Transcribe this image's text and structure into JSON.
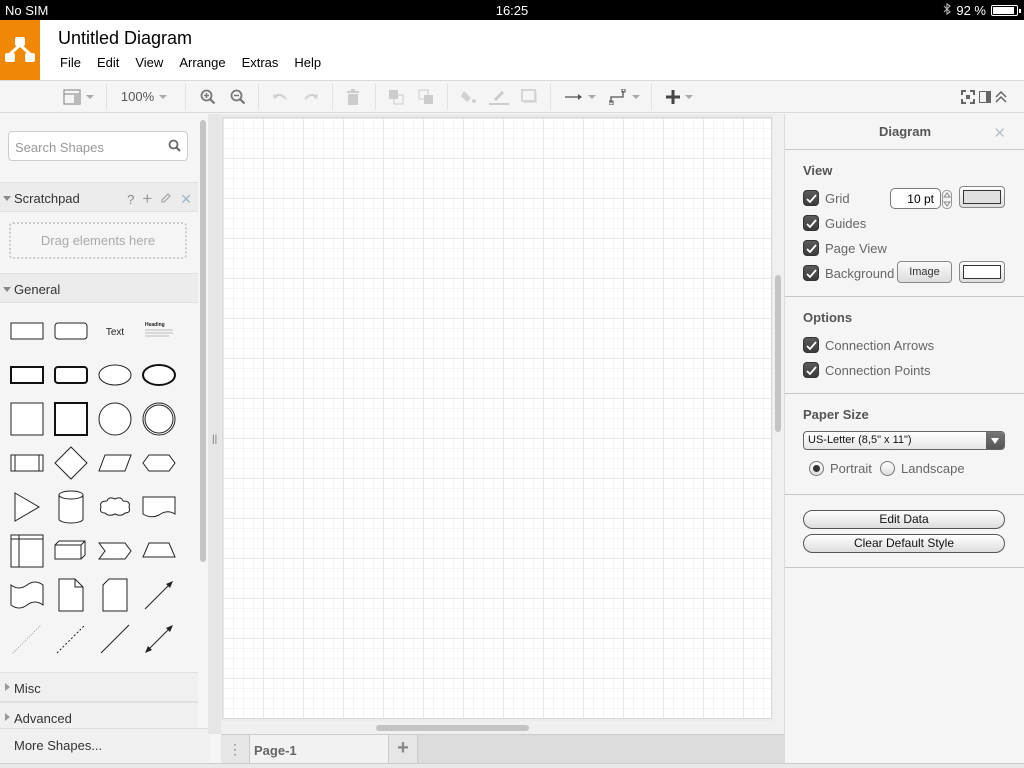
{
  "status_bar": {
    "carrier": "No SIM",
    "time": "16:25",
    "battery_percent_label": "92 %",
    "battery_level": 0.92,
    "bluetooth_icon": "bluetooth-icon"
  },
  "app": {
    "title": "Untitled Diagram",
    "logo_icon": "drawio-logo-icon",
    "brand_color": "#f08705"
  },
  "menu": [
    "File",
    "Edit",
    "View",
    "Arrange",
    "Extras",
    "Help"
  ],
  "toolbar": {
    "zoom_level": "100%",
    "items": [
      "format-panel-toggle-icon",
      "zoom-in-icon",
      "zoom-out-icon",
      "undo-icon",
      "redo-icon",
      "delete-icon",
      "to-front-icon",
      "to-back-icon",
      "fill-color-icon",
      "line-color-icon",
      "shadow-icon",
      "connection-arrow-icon",
      "waypoints-icon",
      "insert-plus-icon",
      "fullscreen-icon",
      "toggle-panel-icon",
      "collapse-icon"
    ]
  },
  "sidebar": {
    "search_placeholder": "Search Shapes",
    "scratchpad": {
      "label": "Scratchpad",
      "help": "?",
      "drop_hint": "Drag elements here"
    },
    "general_label": "General",
    "shapes": [
      "rectangle",
      "rounded-rectangle",
      "text",
      "textbox-heading",
      "rectangle-thick",
      "rounded-rectangle-thick",
      "ellipse",
      "ellipse-thick",
      "square",
      "square-thick",
      "circle",
      "double-circle",
      "process",
      "diamond",
      "parallelogram",
      "hexagon",
      "triangle",
      "cylinder",
      "cloud",
      "document",
      "internal-storage",
      "cube",
      "step",
      "trapezoid",
      "tape",
      "note",
      "card",
      "arrow-line",
      "dotted-line",
      "dashed-line",
      "line",
      "bidirectional-arrow"
    ],
    "text_shape_label": "Text",
    "heading_shape_label": "Heading",
    "collapsed_sections": [
      "Misc",
      "Advanced"
    ],
    "more_shapes": "More Shapes..."
  },
  "pages": {
    "tabs": [
      "Page-1"
    ],
    "active": "Page-1"
  },
  "format_panel": {
    "title": "Diagram",
    "view": {
      "heading": "View",
      "grid": {
        "label": "Grid",
        "checked": true,
        "size": "10 pt",
        "color": "#e0e0e0"
      },
      "guides": {
        "label": "Guides",
        "checked": true
      },
      "page_view": {
        "label": "Page View",
        "checked": true
      },
      "background": {
        "label": "Background",
        "checked": true,
        "image_button": "Image",
        "color": "#ffffff"
      }
    },
    "options": {
      "heading": "Options",
      "connection_arrows": {
        "label": "Connection Arrows",
        "checked": true
      },
      "connection_points": {
        "label": "Connection Points",
        "checked": true
      }
    },
    "paper_size": {
      "heading": "Paper Size",
      "selected": "US-Letter (8,5\" x 11\")",
      "portrait": "Portrait",
      "landscape": "Landscape",
      "orientation": "Portrait"
    },
    "buttons": {
      "edit_data": "Edit Data",
      "clear_default_style": "Clear Default Style"
    }
  }
}
